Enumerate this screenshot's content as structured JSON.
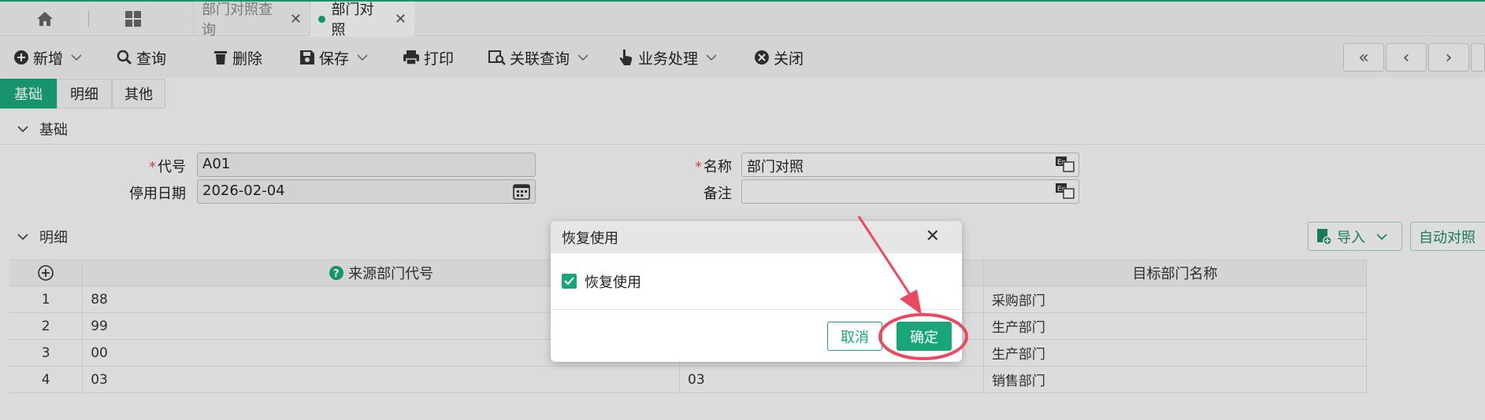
{
  "colors": {
    "accent": "#1aa57a",
    "annotation": "#e84a5f"
  },
  "tabs": {
    "home_icon": "home-icon",
    "apps_icon": "grid-icon",
    "items": [
      {
        "label": "部门对照查询",
        "active": false
      },
      {
        "label": "部门对照",
        "active": true
      }
    ],
    "close_glyph": "✕"
  },
  "toolbar": {
    "add": "新增",
    "query": "查询",
    "delete": "删除",
    "save": "保存",
    "print": "打印",
    "related_query": "关联查询",
    "business": "业务处理",
    "close": "关闭"
  },
  "subtabs": [
    "基础",
    "明细",
    "其他"
  ],
  "basic": {
    "section_title": "基础",
    "code_label": "代号",
    "code_value": "A01",
    "name_label": "名称",
    "name_value": "部门对照",
    "stop_date_label": "停用日期",
    "stop_date_value": "2026-02-04",
    "remark_label": "备注",
    "remark_value": "",
    "required_mark": "*"
  },
  "detail": {
    "section_title": "明细",
    "import_label": "导入",
    "auto_match_label": "自动对照",
    "columns": [
      "来源部门代号",
      "",
      "目标部门名称"
    ],
    "rows": [
      {
        "no": "1",
        "src": "88",
        "tgt_code": "",
        "tgt_name": "采购部门"
      },
      {
        "no": "2",
        "src": "99",
        "tgt_code": "",
        "tgt_name": "生产部门"
      },
      {
        "no": "3",
        "src": "00",
        "tgt_code": "",
        "tgt_name": "生产部门"
      },
      {
        "no": "4",
        "src": "03",
        "tgt_code": "03",
        "tgt_name": "销售部门"
      }
    ]
  },
  "modal": {
    "title": "恢复使用",
    "checkbox_label": "恢复使用",
    "checked": true,
    "cancel": "取消",
    "ok": "确定"
  }
}
